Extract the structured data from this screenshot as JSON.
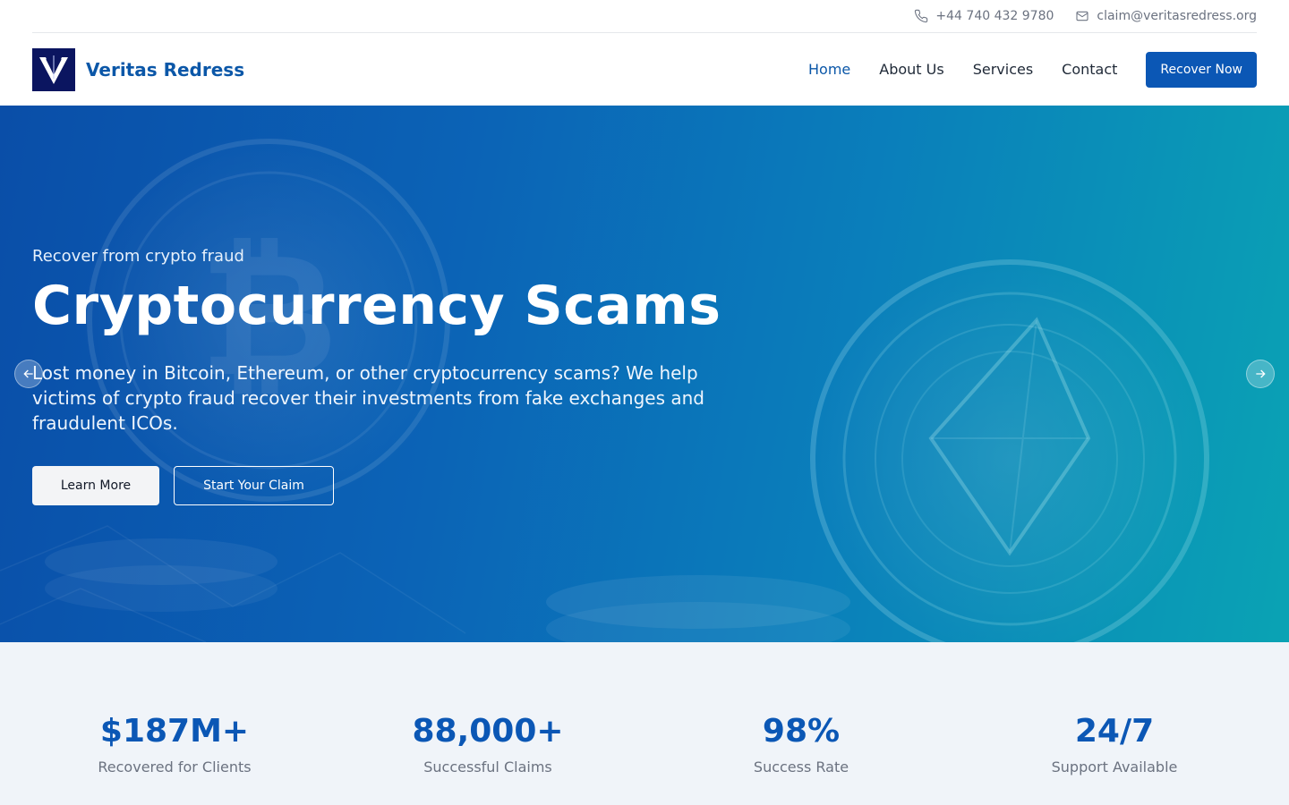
{
  "contact": {
    "phone": "+44 740 432 9780",
    "email": "claim@veritasredress.org"
  },
  "brand": {
    "name": "Veritas Redress",
    "logo_letter": "V"
  },
  "nav": {
    "items": [
      {
        "label": "Home",
        "active": true
      },
      {
        "label": "About Us",
        "active": false
      },
      {
        "label": "Services",
        "active": false
      },
      {
        "label": "Contact",
        "active": false
      }
    ],
    "cta_label": "Recover Now"
  },
  "hero": {
    "eyebrow": "Recover from crypto fraud",
    "title": "Cryptocurrency Scams",
    "description": "Lost money in Bitcoin, Ethereum, or other cryptocurrency scams? We help victims of crypto fraud recover their investments from fake exchanges and fraudulent ICOs.",
    "primary_button": "Learn More",
    "secondary_button": "Start Your Claim"
  },
  "stats": [
    {
      "value": "$187M+",
      "label": "Recovered for Clients"
    },
    {
      "value": "88,000+",
      "label": "Successful Claims"
    },
    {
      "value": "98%",
      "label": "Success Rate"
    },
    {
      "value": "24/7",
      "label": "Support Available"
    }
  ],
  "colors": {
    "brand_blue": "#0b57b5",
    "logo_navy": "#0b1560",
    "stats_bg": "#f0f4f9"
  },
  "icons": [
    "phone-icon",
    "mail-icon",
    "arrow-left-icon",
    "arrow-right-icon"
  ]
}
